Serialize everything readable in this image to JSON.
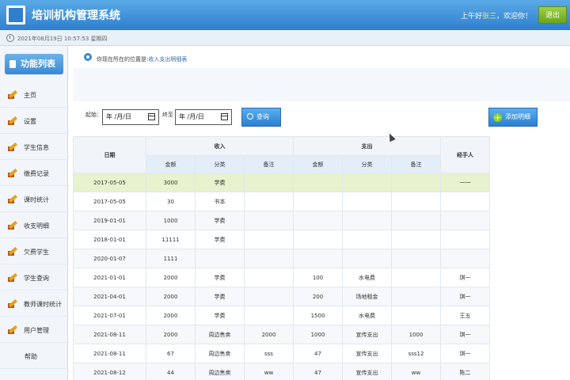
{
  "header": {
    "title": "培训机构管理系统",
    "greeting_prefix": "上午好",
    "user": "张三",
    "greeting_suffix": "，欢迎你！",
    "logout_label": "退出"
  },
  "datebar": {
    "datetime": "2021年08月19日 10:57:53 星期四"
  },
  "sidebar": {
    "title": "功能列表",
    "items": [
      {
        "label": "主页"
      },
      {
        "label": "设置"
      },
      {
        "label": "学生信息"
      },
      {
        "label": "缴费记录"
      },
      {
        "label": "课时统计"
      },
      {
        "label": "收支明细"
      },
      {
        "label": "欠费学生"
      },
      {
        "label": "学生查询"
      },
      {
        "label": "教师课时统计"
      },
      {
        "label": "用户管理"
      },
      {
        "label": "帮助"
      }
    ]
  },
  "location": {
    "prefix": "你现在所在的位置是:",
    "current": "收入支出明细表"
  },
  "filter": {
    "start_label": "起始：",
    "end_label": "终至",
    "start_value": "年 /月/日",
    "end_value": "年 /月/日",
    "query_label": "查询",
    "add_label": "添加明细"
  },
  "table": {
    "headers": {
      "date": "日期",
      "income": "收入",
      "expense": "支出",
      "handler": "经手人",
      "amount": "金额",
      "category": "分类",
      "note": "备注"
    },
    "rows": [
      [
        "2017-05-05",
        "3000",
        "学费",
        "",
        "",
        "",
        "",
        "一一"
      ],
      [
        "2017-05-05",
        "30",
        "书本",
        "",
        "",
        "",
        "",
        ""
      ],
      [
        "2019-01-01",
        "1000",
        "学费",
        "",
        "",
        "",
        "",
        ""
      ],
      [
        "2018-01-01",
        "11111",
        "学费",
        "",
        "",
        "",
        "",
        ""
      ],
      [
        "2020-01-07",
        "1111",
        "",
        "",
        "",
        "",
        "",
        ""
      ],
      [
        "2021-01-01",
        "2000",
        "学费",
        "",
        "100",
        "水电费",
        "",
        "琪一"
      ],
      [
        "2021-04-01",
        "2000",
        "学费",
        "",
        "200",
        "场地租金",
        "",
        "琪一"
      ],
      [
        "2021-07-01",
        "2000",
        "学费",
        "",
        "1500",
        "水电费",
        "",
        "王五"
      ],
      [
        "2021-08-11",
        "2000",
        "周边售卖",
        "2000",
        "1000",
        "宣传支出",
        "1000",
        "琪一"
      ],
      [
        "2021-08-11",
        "67",
        "周边售卖",
        "sss",
        "47",
        "宣传支出",
        "sss12",
        "琪一"
      ],
      [
        "2021-08-12",
        "44",
        "周边售卖",
        "ww",
        "47",
        "宣传支出",
        "ww",
        "陈二"
      ]
    ]
  }
}
